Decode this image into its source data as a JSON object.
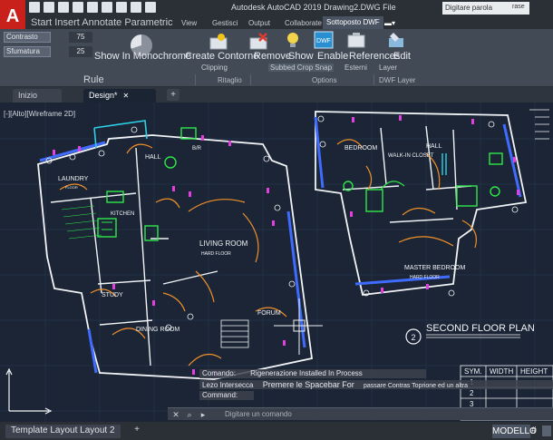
{
  "titlebar": {
    "app_letter": "A",
    "title": "Autodesk AutoCAD 2019  Drawing2.DWG File",
    "search_placeholder": "Digitare parola",
    "search_suffix": "rase"
  },
  "ribbon_tabs": [
    {
      "label": "Start Insert Annotate Parametric"
    },
    {
      "label": "View"
    },
    {
      "label": "Gestisci"
    },
    {
      "label": "Output"
    },
    {
      "label": "Collaborate"
    },
    {
      "label": "Sottoposto DWF"
    }
  ],
  "ribbon": {
    "contrast_label": "Contrasto",
    "contrast_value": "75",
    "fade_label": "Sfumatura",
    "fade_value": "25",
    "btn_monochrome": "Show In Monochrome",
    "btn_create_contour": "Create Contorno",
    "btn_remove": "Remove",
    "btn_show": "Show",
    "btn_enable": "Enable",
    "btn_references": "References",
    "btn_edit": "Edit",
    "sub_clip": "Clipping",
    "sub_snap": "Subbed Crop Snap",
    "sub_esterni": "Esterni",
    "sub_layer": "Layer",
    "panel_rule": "Rule",
    "panel_ritaglio": "Ritaglio",
    "panel_options": "Options",
    "panel_dwf_layer": "DWF Layer"
  },
  "filetabs": {
    "home": "Inizio",
    "design": "Design*",
    "plus": "+"
  },
  "canvas": {
    "viewport_label": "[-][Alto][Wireframe 2D]",
    "rooms": {
      "laundry": "LAUNDRY",
      "hall": "HALL",
      "bath": "B/R",
      "kitchen": "KITCHEN",
      "living": "LIVING ROOM",
      "study": "STUDY",
      "dining": "DINING ROOM",
      "forum": "FORUM",
      "bedroom": "BEDROOM",
      "walkin": "WALK-IN CLOSET",
      "hall2": "HALL",
      "master": "MASTER BEDROOM",
      "floor_tag": "FLOOR",
      "hard_floor": "HARD FLOOR"
    },
    "floor_plan_number": "2",
    "floor_plan_title": "SECOND FLOOR PLAN",
    "table_headers": [
      "SYM.",
      "WIDTH",
      "HEIGHT"
    ],
    "table_rows": [
      [
        "1",
        "",
        ""
      ],
      [
        "2",
        "",
        ""
      ],
      [
        "3",
        "",
        ""
      ]
    ]
  },
  "command": {
    "line1_prefix": "Comando:",
    "line1_text": "Rigenerazione Installed In Process",
    "line2_prefix": "Lezo Intersecca",
    "line2_text": "Premere le Spacebar For",
    "line2_right": "passare Contras Toprione ed un altra",
    "line3": "Command:",
    "input_placeholder": "Digitare un comando"
  },
  "status": {
    "layout_tab": "Template Layout Layout 2",
    "plus": "+",
    "model": "MODELLO",
    "grid": "#"
  }
}
